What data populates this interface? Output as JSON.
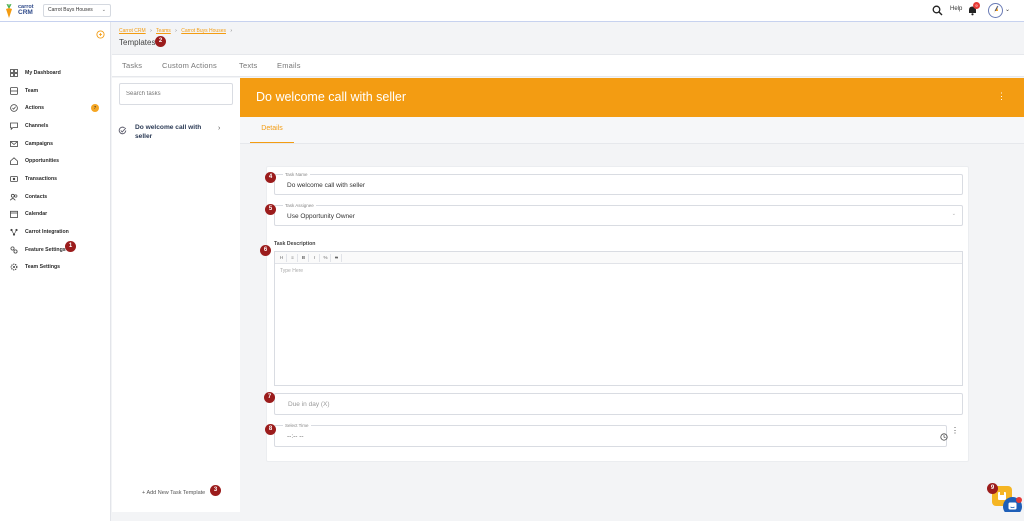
{
  "topbar": {
    "brand_line1": "carrot",
    "brand_line2": "CRM",
    "company": "Carrot Buys Houses",
    "help_label": "Help",
    "notification_count": "9"
  },
  "sidebar": {
    "items": [
      {
        "label": "My Dashboard",
        "icon": "dashboard-icon"
      },
      {
        "label": "Team",
        "icon": "team-icon"
      },
      {
        "label": "Actions",
        "icon": "actions-icon",
        "badge": "7"
      },
      {
        "label": "Channels",
        "icon": "channels-icon"
      },
      {
        "label": "Campaigns",
        "icon": "campaigns-icon"
      },
      {
        "label": "Opportunities",
        "icon": "opportunities-icon"
      },
      {
        "label": "Transactions",
        "icon": "transactions-icon"
      },
      {
        "label": "Contacts",
        "icon": "contacts-icon"
      },
      {
        "label": "Calendar",
        "icon": "calendar-icon"
      },
      {
        "label": "Carrot Integration",
        "icon": "integration-icon"
      },
      {
        "label": "Feature Settings",
        "icon": "feature-settings-icon"
      },
      {
        "label": "Team Settings",
        "icon": "gear-icon"
      }
    ]
  },
  "breadcrumb": {
    "items": [
      "Carrot CRM",
      "Teams",
      "Carrot Buys Houses"
    ]
  },
  "page": {
    "title": "Templates"
  },
  "tabs": [
    "Tasks",
    "Custom Actions",
    "Texts",
    "Emails"
  ],
  "task_panel": {
    "search_placeholder": "Search tasks",
    "task": "Do welcome call with seller",
    "add_label": "Add New Task Template"
  },
  "detail": {
    "title": "Do welcome call with seller",
    "tab": "Details"
  },
  "form": {
    "task_name_label": "Task Name",
    "task_name_value": "Do welcome call with seller",
    "assignee_label": "Task Assignee",
    "assignee_value": "Use Opportunity Owner",
    "description_label": "Task Description",
    "description_placeholder": "Type Here",
    "toolbar": [
      "H",
      "≡",
      "B",
      "I",
      "%",
      "S"
    ],
    "due_placeholder": "Due in day (X)",
    "time_label": "Select Time",
    "time_value": "--:-- --"
  },
  "markers": [
    "1",
    "2",
    "3",
    "4",
    "5",
    "6",
    "7",
    "8",
    "9"
  ],
  "colors": {
    "accent": "#f39c12",
    "marker": "#9b1c1c",
    "badge": "#e53935"
  }
}
